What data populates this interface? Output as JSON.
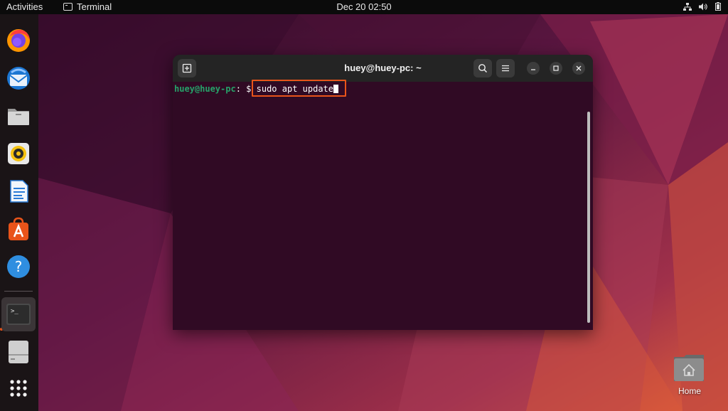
{
  "topbar": {
    "activities": "Activities",
    "app_name": "Terminal",
    "clock": "Dec 20  02:50"
  },
  "dock": {
    "items": [
      "firefox-icon",
      "thunderbird-icon",
      "files-icon",
      "rhythmbox-icon",
      "libreoffice-writer-icon",
      "software-center-icon",
      "help-icon",
      "terminal-icon",
      "disk-icon",
      "app-grid-icon"
    ],
    "accent": "#e8541a"
  },
  "terminal": {
    "title": "huey@huey-pc: ~",
    "prompt_user": "huey@huey-pc",
    "prompt_path": ":",
    "prompt_symbol": " $ ",
    "command": "sudo apt update",
    "background": "#300a24"
  },
  "desktop": {
    "home_label": "Home"
  }
}
